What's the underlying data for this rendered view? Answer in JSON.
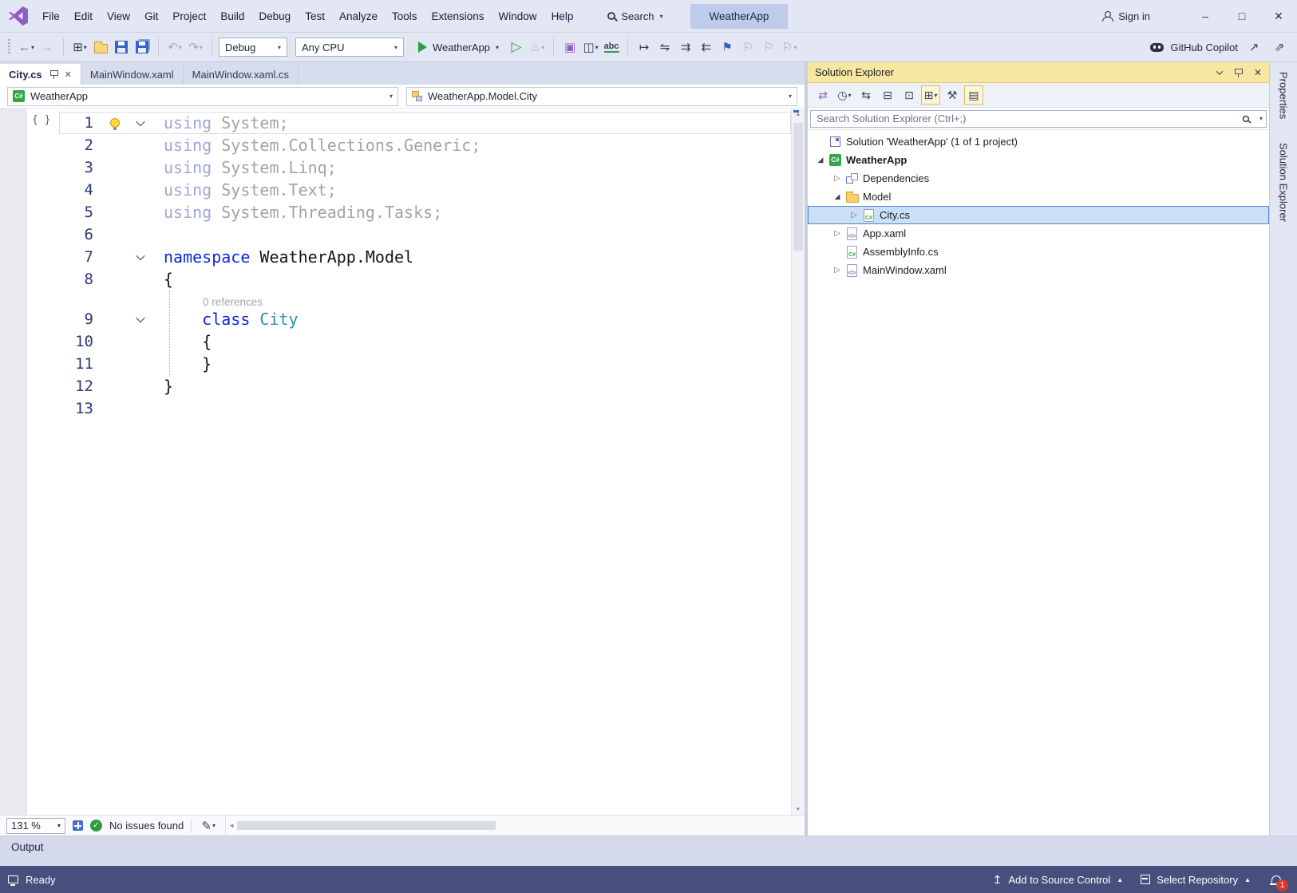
{
  "glyphs": {
    "caret_down": "▾",
    "caret_up": "▲",
    "back": "←",
    "forward": "→",
    "undo": "↶",
    "redo": "↷",
    "play_outline": "▷",
    "hot_reload": "♨",
    "close": "✕",
    "minimize": "–",
    "maximize": "□",
    "scroll_left": "◄",
    "scroll_up": "▲",
    "scroll_down": "▼",
    "check": "✓",
    "pencil": "✎",
    "add_item": "⊞",
    "sync_active": "⇄",
    "history": "◷",
    "switch_views": "⇆",
    "collapse_all": "⊟",
    "copy_layout": "⊡",
    "nested_view": "⊞",
    "wrench": "⚒",
    "preview_items": "▤",
    "expand_open": "◢",
    "expand_closed": "▷",
    "find_window": "▣",
    "split_window": "◫",
    "abc": "abc",
    "goto_margin": "↦",
    "swap_lines": "⇋",
    "indent": "⇉",
    "outdent": "⇇",
    "bookmark": "⚑",
    "bookmark_off": "⚐",
    "share": "↗",
    "feedback": "⇗",
    "arrow_up": "↥",
    "brace_badge": "{ }",
    "csharp": "C#",
    "xaml_mark": "</>"
  },
  "title_bar": {
    "menus": [
      "File",
      "Edit",
      "View",
      "Git",
      "Project",
      "Build",
      "Debug",
      "Test",
      "Analyze",
      "Tools",
      "Extensions",
      "Window",
      "Help"
    ],
    "search_label": "Search",
    "app_title": "WeatherApp",
    "sign_in": "Sign in"
  },
  "toolbar": {
    "configuration": "Debug",
    "platform": "Any CPU",
    "run_target": "WeatherApp",
    "copilot": "GitHub Copilot"
  },
  "editor": {
    "tabs": [
      {
        "label": "City.cs",
        "active": true
      },
      {
        "label": "MainWindow.xaml"
      },
      {
        "label": "MainWindow.xaml.cs"
      }
    ],
    "nav_project": "WeatherApp",
    "nav_member": "WeatherApp.Model.City",
    "zoom": "131 %",
    "issues_status": "No issues found",
    "lines": [
      {
        "n": "1",
        "fold": true,
        "bulb": true,
        "current": true,
        "tokens": [
          [
            "kwf",
            "using"
          ],
          [
            "fade",
            " System;"
          ]
        ]
      },
      {
        "n": "2",
        "tokens": [
          [
            "kwf",
            "using"
          ],
          [
            "fade",
            " System.Collections.Generic;"
          ]
        ]
      },
      {
        "n": "3",
        "tokens": [
          [
            "kwf",
            "using"
          ],
          [
            "fade",
            " System.Linq;"
          ]
        ]
      },
      {
        "n": "4",
        "tokens": [
          [
            "kwf",
            "using"
          ],
          [
            "fade",
            " System.Text;"
          ]
        ]
      },
      {
        "n": "5",
        "tokens": [
          [
            "kwf",
            "using"
          ],
          [
            "fade",
            " System.Threading.Tasks;"
          ]
        ]
      },
      {
        "n": "6",
        "tokens": []
      },
      {
        "n": "7",
        "fold": true,
        "tokens": [
          [
            "kw",
            "namespace"
          ],
          [
            "pln",
            " WeatherApp.Model"
          ]
        ]
      },
      {
        "n": "8",
        "tokens": [
          [
            "pln",
            "{"
          ]
        ]
      },
      {
        "codelens": "0 references"
      },
      {
        "n": "9",
        "fold": true,
        "tokens": [
          [
            "pln",
            "    "
          ],
          [
            "kw",
            "class"
          ],
          [
            "typ",
            " City"
          ]
        ]
      },
      {
        "n": "10",
        "tokens": [
          [
            "pln",
            "    {"
          ]
        ]
      },
      {
        "n": "11",
        "tokens": [
          [
            "pln",
            "    }"
          ]
        ]
      },
      {
        "n": "12",
        "tokens": [
          [
            "pln",
            "}"
          ]
        ]
      },
      {
        "n": "13",
        "tokens": []
      }
    ]
  },
  "solution_explorer": {
    "title": "Solution Explorer",
    "search_placeholder": "Search Solution Explorer (Ctrl+;)",
    "items": [
      {
        "label": "Solution 'WeatherApp' (1 of 1 project)",
        "icon": "solution",
        "indent": 0,
        "expand": "none"
      },
      {
        "label": "WeatherApp",
        "icon": "csproj",
        "indent": 0,
        "expand": "open",
        "bold": true
      },
      {
        "label": "Dependencies",
        "icon": "dependencies",
        "indent": 1,
        "expand": "closed"
      },
      {
        "label": "Model",
        "icon": "folder",
        "indent": 1,
        "expand": "open"
      },
      {
        "label": "City.cs",
        "icon": "csfile",
        "indent": 2,
        "expand": "closed",
        "selected": true
      },
      {
        "label": "App.xaml",
        "icon": "xaml",
        "indent": 1,
        "expand": "closed"
      },
      {
        "label": "AssemblyInfo.cs",
        "icon": "csfile",
        "indent": 1,
        "expand": "none"
      },
      {
        "label": "MainWindow.xaml",
        "icon": "xaml",
        "indent": 1,
        "expand": "closed"
      }
    ]
  },
  "right_strip": {
    "tabs": [
      "Properties",
      "Solution Explorer"
    ]
  },
  "output_panel": {
    "label": "Output"
  },
  "status_bar": {
    "ready": "Ready",
    "add_to_source_control": "Add to Source Control",
    "select_repository": "Select Repository",
    "notification_count": "1"
  }
}
